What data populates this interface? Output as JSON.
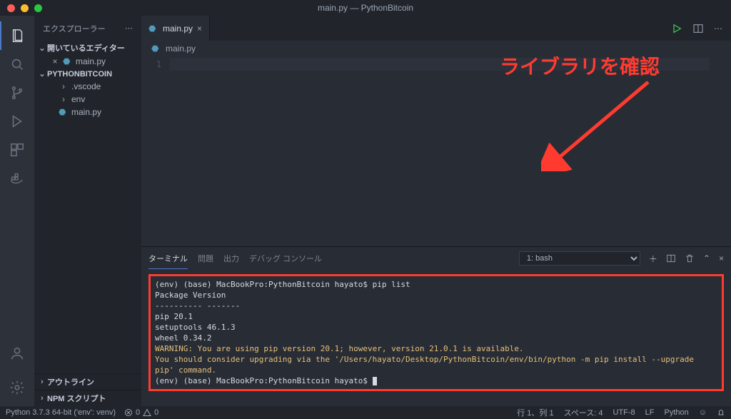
{
  "window": {
    "title": "main.py — PythonBitcoin"
  },
  "sidebar": {
    "title": "エクスプローラー",
    "open_editors_label": "開いているエディター",
    "open_editors": [
      {
        "name": "main.py"
      }
    ],
    "project_label": "PYTHONBITCOIN",
    "tree": [
      {
        "name": ".vscode",
        "type": "folder"
      },
      {
        "name": "env",
        "type": "folder"
      },
      {
        "name": "main.py",
        "type": "file"
      }
    ],
    "outline_label": "アウトライン",
    "npm_label": "NPM スクリプト"
  },
  "tabs": {
    "active": "main.py"
  },
  "breadcrumb": {
    "text": "main.py"
  },
  "editor": {
    "line_numbers": [
      "1"
    ]
  },
  "panel": {
    "tabs": [
      "ターミナル",
      "問題",
      "出力",
      "デバッグ コンソール"
    ],
    "active_tab": "ターミナル",
    "terminal_select": "1: bash",
    "lines": [
      {
        "cls": "term-white",
        "text": "(env) (base) MacBookPro:PythonBitcoin hayato$ pip list"
      },
      {
        "cls": "term-white",
        "text": "Package    Version"
      },
      {
        "cls": "term-white",
        "text": "---------- -------"
      },
      {
        "cls": "term-white",
        "text": "pip        20.1"
      },
      {
        "cls": "term-white",
        "text": "setuptools 46.1.3"
      },
      {
        "cls": "term-white",
        "text": "wheel      0.34.2"
      },
      {
        "cls": "term-yellow",
        "text": "WARNING: You are using pip version 20.1; however, version 21.0.1 is available."
      },
      {
        "cls": "term-yellow",
        "text": "You should consider upgrading via the '/Users/hayato/Desktop/PythonBitcoin/env/bin/python -m pip install --upgrade pip' command."
      },
      {
        "cls": "term-white",
        "text": "(env) (base) MacBookPro:PythonBitcoin hayato$ ",
        "cursor": true
      }
    ]
  },
  "status": {
    "python": "Python 3.7.3 64-bit ('env': venv)",
    "errors": "0",
    "warnings": "0",
    "line_col": "行 1、列 1",
    "spaces": "スペース: 4",
    "encoding": "UTF-8",
    "eol": "LF",
    "lang": "Python"
  },
  "annotation": {
    "text": "ライブラリを確認"
  }
}
